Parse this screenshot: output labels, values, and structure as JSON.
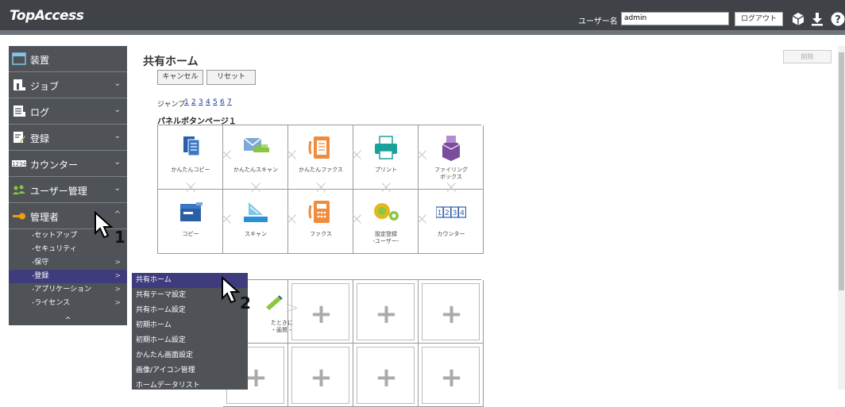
{
  "header": {
    "logo": "TopAccess",
    "user_label": "ユーザー名",
    "username": "admin",
    "logout": "ログアウト",
    "icons": [
      "box-icon",
      "download-icon",
      "help-icon"
    ]
  },
  "sidebar": {
    "menus": [
      {
        "label": "装置",
        "icon": "device-icon",
        "chevron": ""
      },
      {
        "label": "ジョブ",
        "icon": "job-icon",
        "chevron": "⌄"
      },
      {
        "label": "ログ",
        "icon": "log-icon",
        "chevron": "⌄"
      },
      {
        "label": "登録",
        "icon": "register-icon",
        "chevron": "⌄"
      },
      {
        "label": "カウンター",
        "icon": "counter-icon",
        "chevron": "⌄"
      },
      {
        "label": "ユーザー管理",
        "icon": "users-icon",
        "chevron": "⌄"
      },
      {
        "label": "管理者",
        "icon": "key-icon",
        "chevron": "^"
      }
    ],
    "submenu": [
      {
        "label": "-セットアップ",
        "arrow": ""
      },
      {
        "label": "-セキュリティ",
        "arrow": ""
      },
      {
        "label": "-保守",
        "arrow": ">"
      },
      {
        "label": "-登録",
        "arrow": ">"
      },
      {
        "label": "-アプリケーション",
        "arrow": ">"
      },
      {
        "label": "-ライセンス",
        "arrow": ">"
      }
    ],
    "collapse": "^"
  },
  "main": {
    "title": "共有ホーム",
    "cancel": "キャンセル",
    "reset": "リセット",
    "delete": "削除",
    "jump_label": "ジャンプ",
    "jump_pages": [
      "1",
      "2",
      "3",
      "4",
      "5",
      "6",
      "7"
    ],
    "panel_title": "パネルボタンページ１",
    "row1": [
      "かんたんコピー",
      "かんたんスキャン",
      "かんたんファクス",
      "プリント",
      "ファイリング\nボックス"
    ],
    "row2": [
      "コピー",
      "スキャン",
      "ファクス",
      "設定登録\n-ユーザー-",
      "カウンター"
    ],
    "partial_caption": "たときに\n・画質・",
    "plus": "+"
  },
  "flyout": {
    "items": [
      "共有ホーム",
      "共有テーマ設定",
      "共有ホーム設定",
      "初期ホーム",
      "初期ホーム設定",
      "かんたん画面設定",
      "画像/アイコン管理",
      "ホームデータリスト"
    ]
  },
  "annotations": {
    "step1": "1",
    "step2": "2"
  }
}
